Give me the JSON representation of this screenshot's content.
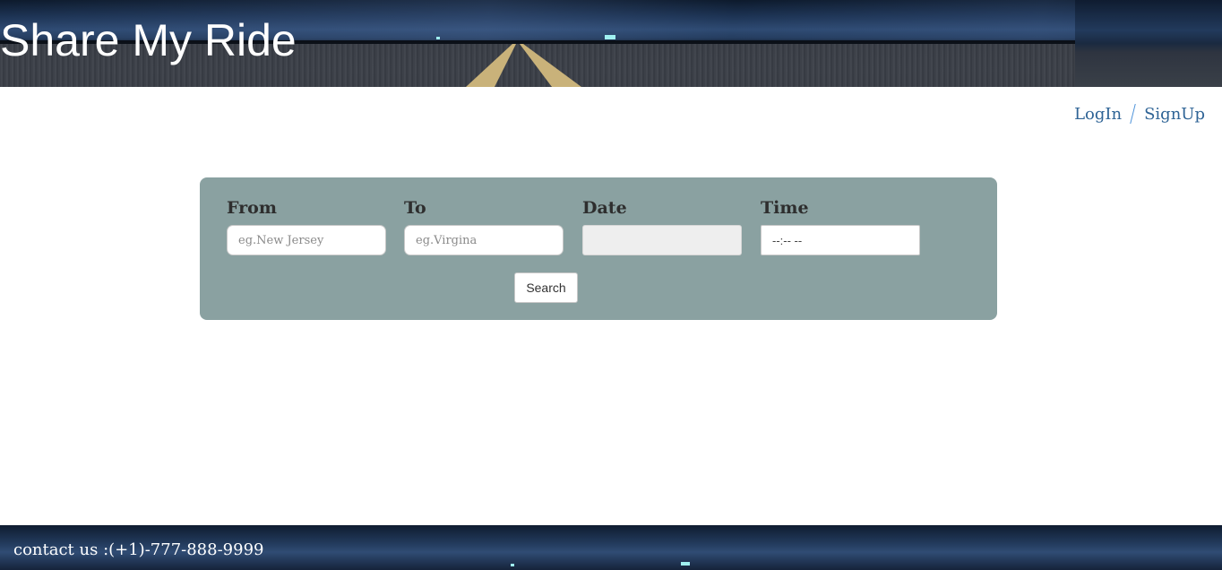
{
  "header": {
    "title": "Share My Ride"
  },
  "auth": {
    "login_label": "LogIn",
    "signup_label": "SignUp"
  },
  "search": {
    "from": {
      "label": "From",
      "placeholder": "eg.New Jersey",
      "value": ""
    },
    "to": {
      "label": "To",
      "placeholder": "eg.Virgina",
      "value": ""
    },
    "date": {
      "label": "Date",
      "value": ""
    },
    "time": {
      "label": "Time",
      "value": "--:-- --"
    },
    "button_label": "Search"
  },
  "footer": {
    "contact_text": "contact us :(+1)-777-888-9999"
  },
  "colors": {
    "panel": "#8aa1a1",
    "link": "#2f6496",
    "separator": "#4a90d9"
  }
}
